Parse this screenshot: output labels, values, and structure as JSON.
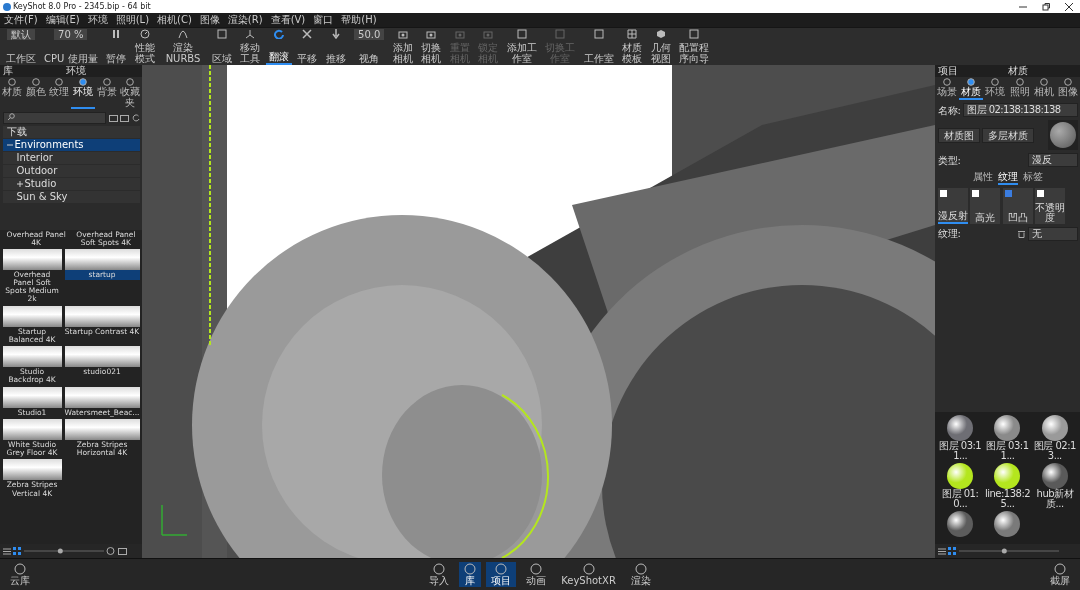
{
  "window": {
    "title": "KeyShot 8.0 Pro  - 2345.bip  - 64 bit"
  },
  "menu": [
    "文件(F)",
    "编辑(E)",
    "环境",
    "照明(L)",
    "相机(C)",
    "图像",
    "渲染(R)",
    "查看(V)",
    "窗口",
    "帮助(H)"
  ],
  "toolbar": [
    {
      "label": "工作区",
      "kind": "dropdown",
      "value": "默认",
      "selected": false,
      "disabled": false
    },
    {
      "label": "CPU 使用量",
      "kind": "dropdown",
      "value": "70 %",
      "selected": false,
      "disabled": false
    },
    {
      "label": "暂停",
      "kind": "pause",
      "selected": false,
      "disabled": false
    },
    {
      "label": "性能模式",
      "kind": "gauge",
      "selected": false,
      "disabled": false
    },
    {
      "label": "渲染 NURBS",
      "kind": "curve",
      "selected": false,
      "disabled": false
    },
    {
      "label": "区域",
      "kind": "frame",
      "selected": false,
      "disabled": false
    },
    {
      "label": "移动工具",
      "kind": "axes",
      "selected": false,
      "disabled": false
    },
    {
      "label": "翻滚",
      "kind": "rotate",
      "selected": true,
      "disabled": false
    },
    {
      "label": "平移",
      "kind": "pan",
      "selected": false,
      "disabled": false
    },
    {
      "label": "推移",
      "kind": "dolly",
      "selected": false,
      "disabled": false
    },
    {
      "label": "视角",
      "kind": "field",
      "value": "50.0",
      "selected": false,
      "disabled": false
    },
    {
      "label": "添加相机",
      "kind": "camera",
      "selected": false,
      "disabled": false
    },
    {
      "label": "切换相机",
      "kind": "camera",
      "selected": false,
      "disabled": false
    },
    {
      "label": "重置相机",
      "kind": "camera",
      "selected": false,
      "disabled": true
    },
    {
      "label": "锁定相机",
      "kind": "camera",
      "selected": false,
      "disabled": true
    },
    {
      "label": "添加工作室",
      "kind": "frame",
      "selected": false,
      "disabled": false
    },
    {
      "label": "切换工作室",
      "kind": "frame",
      "selected": false,
      "disabled": true
    },
    {
      "label": "工作室",
      "kind": "frame",
      "selected": false,
      "disabled": false
    },
    {
      "label": "材质模板",
      "kind": "grid",
      "selected": false,
      "disabled": false
    },
    {
      "label": "几何视图",
      "kind": "cube",
      "selected": false,
      "disabled": false
    },
    {
      "label": "配置程序向导",
      "kind": "frame",
      "selected": false,
      "disabled": false
    }
  ],
  "library": {
    "header": "库",
    "title": "环境",
    "tabs": [
      {
        "label": "材质",
        "selected": false
      },
      {
        "label": "颜色",
        "selected": false
      },
      {
        "label": "纹理",
        "selected": false
      },
      {
        "label": "环境",
        "selected": true
      },
      {
        "label": "背景",
        "selected": false
      },
      {
        "label": "收藏夹",
        "selected": false
      }
    ],
    "tree": [
      {
        "label": "下载",
        "selected": false
      },
      {
        "label": "Environments",
        "selected": true,
        "expanded": true,
        "children": [
          {
            "label": "Interior",
            "selected": false
          },
          {
            "label": "Outdoor",
            "selected": false
          },
          {
            "label": "Studio",
            "selected": false,
            "expanded": false,
            "has_children": true
          },
          {
            "label": "Sun & Sky",
            "selected": false
          }
        ]
      }
    ],
    "zoom_slider": {
      "level": 0.45
    },
    "cut_labels": [
      "Overhead Panel 4K",
      "Overhead Panel Soft Spots 4K"
    ],
    "items": [
      {
        "label": "Overhead Panel Soft Spots Medium 2k",
        "selected": false
      },
      {
        "label": "startup",
        "selected": true
      },
      {
        "label": "Startup Balanced 4K",
        "selected": false
      },
      {
        "label": "Startup Contrast 4K",
        "selected": false
      },
      {
        "label": "Studio Backdrop 4K",
        "selected": false
      },
      {
        "label": "studio021",
        "selected": false
      },
      {
        "label": "Studio1",
        "selected": false
      },
      {
        "label": "Watersmeet_Beac...",
        "selected": false
      },
      {
        "label": "White Studio Grey Floor 4K",
        "selected": false
      },
      {
        "label": "Zebra Stripes Horizontal 4K",
        "selected": false
      },
      {
        "label": "Zebra Stripes Vertical 4K",
        "selected": false
      }
    ]
  },
  "project": {
    "header": "项目",
    "title": "材质",
    "tabs": [
      {
        "label": "场景",
        "selected": false
      },
      {
        "label": "材质",
        "selected": true
      },
      {
        "label": "环境",
        "selected": false
      },
      {
        "label": "照明",
        "selected": false
      },
      {
        "label": "相机",
        "selected": false
      },
      {
        "label": "图像",
        "selected": false
      }
    ],
    "name_label": "名称:",
    "name_value": "图层 02:138:138:138",
    "buttons": [
      "材质图",
      "多层材质"
    ],
    "type_label": "类型:",
    "type_value": "漫反",
    "sub_tabs": [
      {
        "label": "属性",
        "selected": false
      },
      {
        "label": "纹理",
        "selected": true
      },
      {
        "label": "标签",
        "selected": false
      }
    ],
    "slots": [
      {
        "label": "漫反射",
        "checked": false,
        "selected": true
      },
      {
        "label": "高光",
        "checked": false,
        "selected": false
      },
      {
        "label": "凹凸",
        "checked": true,
        "selected": false
      },
      {
        "label": "不透明度",
        "checked": false,
        "selected": false
      }
    ],
    "texture_label": "纹理:",
    "texture_value": "无",
    "materials": [
      {
        "label": "图层 03:11...",
        "color": "#6e6e74"
      },
      {
        "label": "图层 03:11...",
        "color": "#8a8a8a"
      },
      {
        "label": "图层 02:13...",
        "color": "#9a9a9a"
      },
      {
        "label": "图层 01:0...",
        "color": "#b4e61e"
      },
      {
        "label": "line:138:25...",
        "color": "#b4e61e"
      },
      {
        "label": "hub新材质...",
        "color": "#5a5a5a"
      },
      {
        "color": "#5c5c5c"
      },
      {
        "color": "#7a7a7a"
      }
    ]
  },
  "material_zoom_slider": {
    "level": 0.45
  },
  "bottom_bar": {
    "left": "云库",
    "center": [
      {
        "label": "导入",
        "selected": false
      },
      {
        "label": "库",
        "selected": true
      },
      {
        "label": "项目",
        "selected": true
      },
      {
        "label": "动画",
        "selected": false
      },
      {
        "label": "KeyShotXR",
        "selected": false
      },
      {
        "label": "渲染",
        "selected": false
      }
    ],
    "right": "截屏"
  }
}
